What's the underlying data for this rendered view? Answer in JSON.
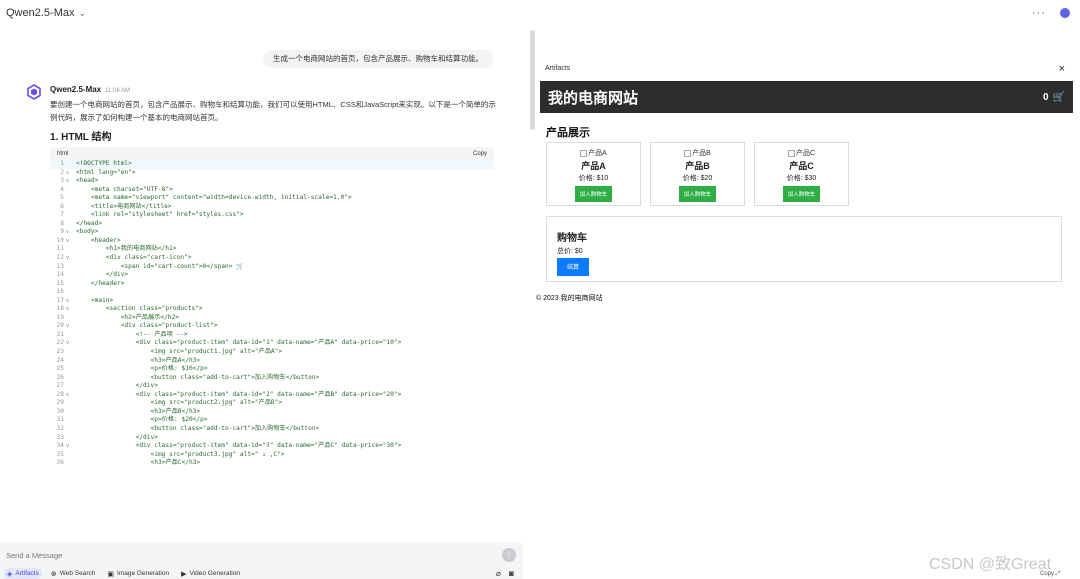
{
  "topbar": {
    "model": "Qwen2.5-Max",
    "chevron_icon": "chevron-down-icon",
    "more": "···",
    "avatar_color": "#5b62e6"
  },
  "chat": {
    "user_message": "生成一个电商网站的首页，包含产品展示、购物车和结算功能。",
    "bot": {
      "name": "Qwen2.5-Max",
      "time": "11:06 AM",
      "intro": "要创建一个电商网站的首页，包含产品展示、购物车和结算功能，我们可以使用HTML、CSS和JavaScript来实现。以下是一个简单的示例代码，展示了如何构建一个基本的电商网站首页。",
      "heading": "1. HTML 结构"
    },
    "code": {
      "lang": "html",
      "copy_label": "Copy",
      "lines": [
        {
          "n": "1",
          "fold": "",
          "t": "<!DOCTYPE html>"
        },
        {
          "n": "2",
          "fold": "v",
          "t": "<html lang=\"en\">"
        },
        {
          "n": "3",
          "fold": "v",
          "t": "<head>"
        },
        {
          "n": "4",
          "fold": "",
          "t": "    <meta charset=\"UTF-8\">"
        },
        {
          "n": "5",
          "fold": "",
          "t": "    <meta name=\"viewport\" content=\"width=device-width, initial-scale=1.0\">"
        },
        {
          "n": "6",
          "fold": "",
          "t": "    <title>电商网站</title>"
        },
        {
          "n": "7",
          "fold": "",
          "t": "    <link rel=\"stylesheet\" href=\"styles.css\">"
        },
        {
          "n": "8",
          "fold": "",
          "t": "</head>"
        },
        {
          "n": "9",
          "fold": "v",
          "t": "<body>"
        },
        {
          "n": "10",
          "fold": "v",
          "t": "    <header>"
        },
        {
          "n": "11",
          "fold": "",
          "t": "        <h1>我的电商网站</h1>"
        },
        {
          "n": "12",
          "fold": "v",
          "t": "        <div class=\"cart-icon\">"
        },
        {
          "n": "13",
          "fold": "",
          "t": "            <span id=\"cart-count\">0</span> 🛒"
        },
        {
          "n": "14",
          "fold": "",
          "t": "        </div>"
        },
        {
          "n": "15",
          "fold": "",
          "t": "    </header>"
        },
        {
          "n": "16",
          "fold": "",
          "t": ""
        },
        {
          "n": "17",
          "fold": "v",
          "t": "    <main>"
        },
        {
          "n": "18",
          "fold": "v",
          "t": "        <section class=\"products\">"
        },
        {
          "n": "19",
          "fold": "",
          "t": "            <h2>产品展示</h2>"
        },
        {
          "n": "20",
          "fold": "v",
          "t": "            <div class=\"product-list\">"
        },
        {
          "n": "21",
          "fold": "",
          "t": "                <!-- 产品项 -->"
        },
        {
          "n": "22",
          "fold": "v",
          "t": "                <div class=\"product-item\" data-id=\"1\" data-name=\"产品A\" data-price=\"10\">"
        },
        {
          "n": "23",
          "fold": "",
          "t": "                    <img src=\"product1.jpg\" alt=\"产品A\">"
        },
        {
          "n": "24",
          "fold": "",
          "t": "                    <h3>产品A</h3>"
        },
        {
          "n": "25",
          "fold": "",
          "t": "                    <p>价格: $10</p>"
        },
        {
          "n": "26",
          "fold": "",
          "t": "                    <button class=\"add-to-cart\">加入购物车</button>"
        },
        {
          "n": "27",
          "fold": "",
          "t": "                </div>"
        },
        {
          "n": "28",
          "fold": "v",
          "t": "                <div class=\"product-item\" data-id=\"2\" data-name=\"产品B\" data-price=\"20\">"
        },
        {
          "n": "29",
          "fold": "",
          "t": "                    <img src=\"product2.jpg\" alt=\"产品B\">"
        },
        {
          "n": "30",
          "fold": "",
          "t": "                    <h3>产品B</h3>"
        },
        {
          "n": "31",
          "fold": "",
          "t": "                    <p>价格: $20</p>"
        },
        {
          "n": "32",
          "fold": "",
          "t": "                    <button class=\"add-to-cart\">加入购物车</button>"
        },
        {
          "n": "33",
          "fold": "",
          "t": "                </div>"
        },
        {
          "n": "34",
          "fold": "v",
          "t": "                <div class=\"product-item\" data-id=\"3\" data-name=\"产品C\" data-price=\"30\">"
        },
        {
          "n": "35",
          "fold": "",
          "t": "                    <img src=\"product3.jpg\" alt=\" ↓ ,C\">"
        },
        {
          "n": "36",
          "fold": "",
          "t": "                    <h3>产品C</h3>"
        }
      ]
    },
    "composer": {
      "placeholder": "Send a Message",
      "tools": [
        {
          "label": "Artifacts",
          "icon": "◈",
          "active": true
        },
        {
          "label": "Web Search",
          "icon": "⊕",
          "active": false
        },
        {
          "label": "Image Generation",
          "icon": "▣",
          "active": false
        },
        {
          "label": "Video Generation",
          "icon": "▶",
          "active": false
        }
      ]
    }
  },
  "artifact": {
    "title": "Artifacts",
    "close_icon": "×",
    "shop": {
      "title": "我的电商网站",
      "cart_count": "0",
      "cart_icon": "🛒",
      "section_title": "产品展示",
      "products": [
        {
          "img_alt": "产品A",
          "name": "产品A",
          "price": "价格: $10",
          "button": "加入购物车"
        },
        {
          "img_alt": "产品B",
          "name": "产品B",
          "price": "价格: $20",
          "button": "加入购物车"
        },
        {
          "img_alt": "产品C",
          "name": "产品C",
          "price": "价格: $30",
          "button": "加入购物车"
        }
      ],
      "cart_title": "购物车",
      "cart_total": "总价: $0",
      "checkout": "结算",
      "footer": "© 2023 我的电商网站"
    }
  },
  "bottom_right": "Copy ⤢",
  "watermark": "CSDN @致Great",
  "colors": {
    "header_bg": "#2d2d2d",
    "add_btn": "#2eae45",
    "checkout_btn": "#0d7bff",
    "active_tool": "#3e48d1"
  }
}
